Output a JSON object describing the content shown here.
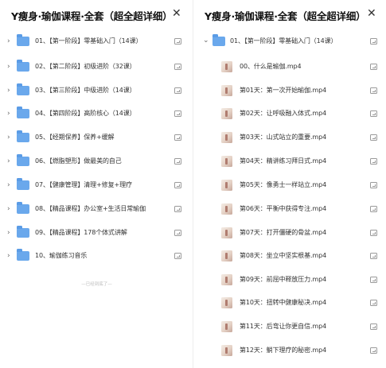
{
  "left_panel": {
    "title": "Y瘦身·瑜伽课程·全套（超全超详细）",
    "close_glyph": "✕",
    "folders": [
      {
        "label": "01、【第一阶段】零基础入门（14课）"
      },
      {
        "label": "02、【第二阶段】初级进阶（32课）"
      },
      {
        "label": "03、【第三阶段】中级进阶（14课）"
      },
      {
        "label": "04、【第四阶段】高阶核心（14课）"
      },
      {
        "label": "05、【经期保养】保养+缓解"
      },
      {
        "label": "06、【燃脂塑形】做最美的自己"
      },
      {
        "label": "07、【健康管理】清理+修复+理疗"
      },
      {
        "label": "08、【精品课程】办公室+生活日常瑜伽"
      },
      {
        "label": "09、【精品课程】178个体式讲解"
      },
      {
        "label": "10、瑜伽练习音乐"
      }
    ],
    "footer_note": "—已经到底了—"
  },
  "right_panel": {
    "title": "Y瘦身·瑜伽课程·全套（超全超详细）",
    "close_glyph": "✕",
    "expanded_folder": {
      "label": "01、【第一阶段】零基础入门（14课）"
    },
    "files": [
      {
        "label": "00、什么是瑜伽.mp4"
      },
      {
        "label": "第01天：第一次开始瑜伽.mp4"
      },
      {
        "label": "第02天：让呼吸融入体式.mp4"
      },
      {
        "label": "第03天：山式站立的重要.mp4"
      },
      {
        "label": "第04天：精讲练习拜日式.mp4"
      },
      {
        "label": "第05天：像勇士一样站立.mp4"
      },
      {
        "label": "第06天：平衡中获得专注.mp4"
      },
      {
        "label": "第07天：打开僵硬的骨盆.mp4"
      },
      {
        "label": "第08天：坐立中坚实根基.mp4"
      },
      {
        "label": "第09天：前屈中释放压力.mp4"
      },
      {
        "label": "第10天：扭转中健康秘决.mp4"
      },
      {
        "label": "第11天：后弯让你更自信.mp4"
      },
      {
        "label": "第12天：躺下理疗的秘密.mp4"
      }
    ]
  },
  "icons": {
    "chevron_collapsed": "›",
    "chevron_expanded": "⌄",
    "folder_color": "#6aa8ec"
  }
}
